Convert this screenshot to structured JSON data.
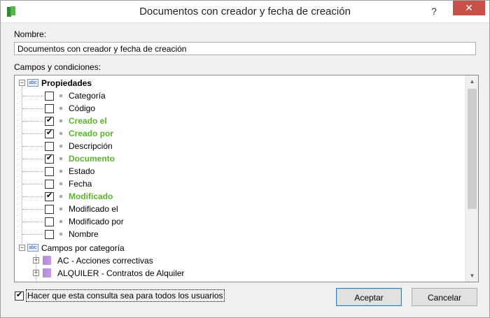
{
  "window": {
    "title": "Documentos con creador y fecha de creación",
    "help_glyph": "?",
    "close_glyph": "✕"
  },
  "form": {
    "name_label": "Nombre:",
    "name_value": "Documentos con creador y fecha de creación",
    "fields_label": "Campos y condiciones:"
  },
  "tree": {
    "root": {
      "label": "Propiedades",
      "icon": "abc-icon",
      "expanded": true
    },
    "properties": [
      {
        "label": "Categoría",
        "checked": false
      },
      {
        "label": "Código",
        "checked": false
      },
      {
        "label": "Creado el",
        "checked": true
      },
      {
        "label": "Creado por",
        "checked": true
      },
      {
        "label": "Descripción",
        "checked": false
      },
      {
        "label": "Documento",
        "checked": true
      },
      {
        "label": "Estado",
        "checked": false
      },
      {
        "label": "Fecha",
        "checked": false
      },
      {
        "label": "Modificado",
        "checked": true
      },
      {
        "label": "Modificado el",
        "checked": false
      },
      {
        "label": "Modificado por",
        "checked": false
      },
      {
        "label": "Nombre",
        "checked": false
      }
    ],
    "category_root": {
      "label": "Campos por categoría",
      "icon": "abc-icon",
      "expanded": true
    },
    "categories": [
      {
        "label": "AC - Acciones correctivas",
        "icon": "folder-icon"
      },
      {
        "label": "ALQUILER - Contratos de Alquiler",
        "icon": "folder-icon"
      }
    ],
    "check_glyph": "✔",
    "plus_glyph": "+",
    "minus_glyph": "−",
    "checked_color": "#5bb52b"
  },
  "footer": {
    "all_users_label": "Hacer que esta consulta sea para todos los usuarios",
    "all_users_checked": true,
    "accept_label": "Aceptar",
    "cancel_label": "Cancelar"
  },
  "colors": {
    "close_button": "#c7504b",
    "checked_text": "#5bb52b"
  }
}
